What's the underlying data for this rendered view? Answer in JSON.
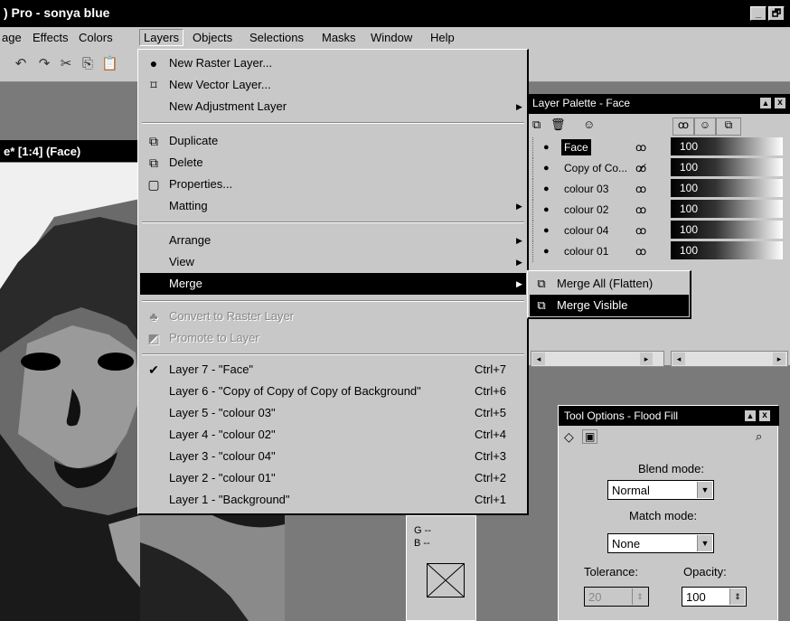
{
  "window": {
    "title": ") Pro - sonya blue",
    "controls": [
      "_",
      "🗗"
    ]
  },
  "menubar": {
    "items": [
      "age",
      "Effects",
      "Colors",
      "Layers",
      "Objects",
      "Selections",
      "Masks",
      "Window",
      "Help"
    ],
    "active": "Layers"
  },
  "document": {
    "title": "e* [1:4] (Face)"
  },
  "layers_menu": {
    "items": [
      {
        "label": "New Raster Layer...",
        "icon": "new-raster-layer-icon"
      },
      {
        "label": "New Vector Layer...",
        "icon": "new-vector-layer-icon"
      },
      {
        "label": "New Adjustment Layer",
        "icon": ""
      },
      {
        "label": "Duplicate",
        "icon": "duplicate-icon"
      },
      {
        "label": "Delete",
        "icon": "delete-icon"
      },
      {
        "label": "Properties...",
        "icon": "properties-icon"
      },
      {
        "label": "Matting",
        "icon": ""
      },
      {
        "label": "Arrange",
        "icon": ""
      },
      {
        "label": "View",
        "icon": ""
      },
      {
        "label": "Merge",
        "icon": ""
      },
      {
        "label": "Convert to Raster Layer",
        "icon": "convert-icon"
      },
      {
        "label": "Promote to Layer",
        "icon": "promote-icon"
      },
      {
        "label": "Layer 7 - \"Face\"",
        "shortcut": "Ctrl+7"
      },
      {
        "label": "Layer 6 - \"Copy of Copy of Copy of Background\"",
        "shortcut": "Ctrl+6"
      },
      {
        "label": "Layer 5 - \"colour 03\"",
        "shortcut": "Ctrl+5"
      },
      {
        "label": "Layer 4 - \"colour 02\"",
        "shortcut": "Ctrl+4"
      },
      {
        "label": "Layer 3 - \"colour 04\"",
        "shortcut": "Ctrl+3"
      },
      {
        "label": "Layer 2 - \"colour 01\"",
        "shortcut": "Ctrl+2"
      },
      {
        "label": "Layer 1 - \"Background\"",
        "shortcut": "Ctrl+1"
      }
    ],
    "checkmark": "✔"
  },
  "merge_submenu": {
    "items": [
      "Merge All (Flatten)",
      "Merge Visible"
    ]
  },
  "layer_palette": {
    "title": "Layer Palette - Face",
    "layers": [
      {
        "name": "Face",
        "opacity": "100"
      },
      {
        "name": "Copy of Co...",
        "opacity": "100"
      },
      {
        "name": "colour 03",
        "opacity": "100"
      },
      {
        "name": "colour 02",
        "opacity": "100"
      },
      {
        "name": "colour 04",
        "opacity": "100"
      },
      {
        "name": "colour 01",
        "opacity": "100"
      }
    ],
    "close": "x",
    "scroll_left": "◂",
    "scroll_right": "▸"
  },
  "tool_options": {
    "title": "Tool Options - Flood Fill",
    "blend_mode_label": "Blend mode:",
    "blend_mode_value": "Normal",
    "match_mode_label": "Match mode:",
    "match_mode_value": "None",
    "tolerance_label": "Tolerance:",
    "tolerance_value": "20",
    "opacity_label": "Opacity:",
    "opacity_value": "100"
  },
  "color_box": {
    "g_label": "G --",
    "b_label": "B --"
  }
}
